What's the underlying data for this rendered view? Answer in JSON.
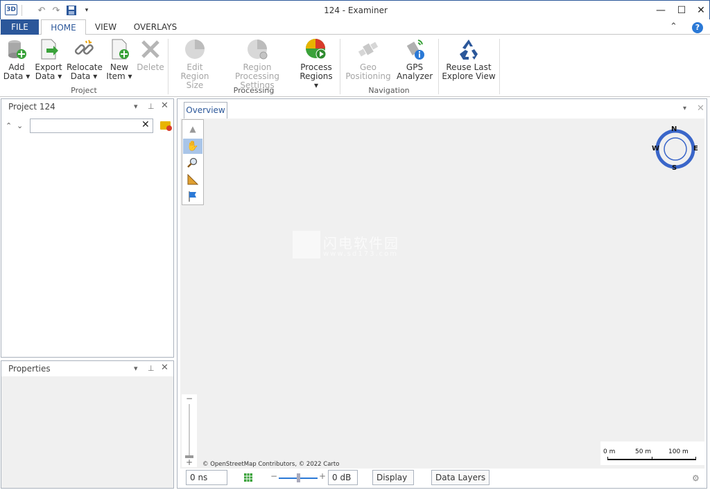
{
  "window": {
    "title": "124 - Examiner"
  },
  "tabs": [
    {
      "label": "FILE"
    },
    {
      "label": "HOME"
    },
    {
      "label": "VIEW"
    },
    {
      "label": "OVERLAYS"
    }
  ],
  "ribbon": {
    "project": {
      "label": "Project",
      "buttons": [
        {
          "line1": "Add",
          "line2": "Data ▾"
        },
        {
          "line1": "Export",
          "line2": "Data ▾"
        },
        {
          "line1": "Relocate",
          "line2": "Data ▾"
        },
        {
          "line1": "New",
          "line2": "Item ▾"
        },
        {
          "line1": "Delete",
          "line2": ""
        }
      ]
    },
    "processing": {
      "label": "Processing",
      "buttons": [
        {
          "line1": "Edit Region",
          "line2": "Size"
        },
        {
          "line1": "Region Processing",
          "line2": "Settings"
        },
        {
          "line1": "Process",
          "line2": "Regions ▾"
        }
      ]
    },
    "navigation": {
      "label": "Navigation",
      "buttons": [
        {
          "line1": "Geo",
          "line2": "Positioning"
        },
        {
          "line1": "GPS",
          "line2": "Analyzer"
        },
        {
          "line1": "Reuse Last",
          "line2": "Explore View"
        }
      ]
    }
  },
  "project_panel": {
    "title": "Project 124",
    "search_value": ""
  },
  "properties_panel": {
    "title": "Properties"
  },
  "overview": {
    "tab": "Overview",
    "attribution": "© OpenStreetMap Contributors, © 2022 Carto",
    "compass": {
      "n": "N",
      "s": "S",
      "e": "E",
      "w": "W"
    },
    "scale": {
      "labels": [
        "0 m",
        "50 m",
        "100 m"
      ]
    },
    "zoom": {
      "minus": "−",
      "plus": "+"
    }
  },
  "statusbar": {
    "time": "0 ns",
    "gain": "0 dB",
    "display_label": "Display",
    "data_layers_label": "Data Layers",
    "slider_minus": "−",
    "slider_plus": "+"
  },
  "watermark": {
    "text": "闪电软件园",
    "url": "www.sd173.com"
  },
  "colors": {
    "accent": "#2b579a",
    "map_bg": "#f0f0f0",
    "compass": "#3a66c9"
  }
}
